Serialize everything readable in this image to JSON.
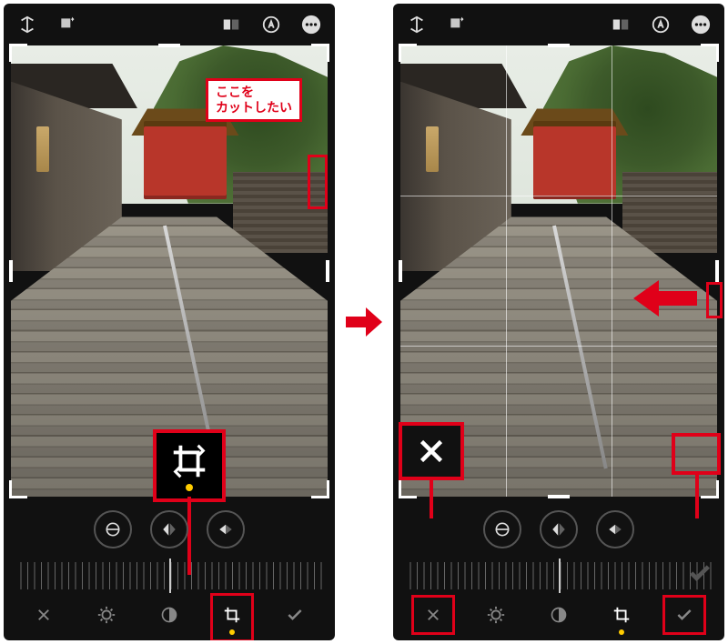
{
  "callout": {
    "line1": "ここを",
    "line2": "カットしたい"
  },
  "icons": {
    "flip_v": "flip-vertical-icon",
    "rotate": "rotate-icon",
    "compare": "compare-icon",
    "auto": "auto-icon",
    "more": "more-icon",
    "straighten": "straighten-icon",
    "flip_h": "flip-horizontal-icon",
    "perspective": "perspective-icon",
    "cancel": "close-icon",
    "exposure": "exposure-icon",
    "contrast": "contrast-icon",
    "crop": "crop-rotate-icon",
    "confirm": "check-icon"
  },
  "colors": {
    "highlight": "#e00019",
    "accent": "#ffcc00"
  }
}
